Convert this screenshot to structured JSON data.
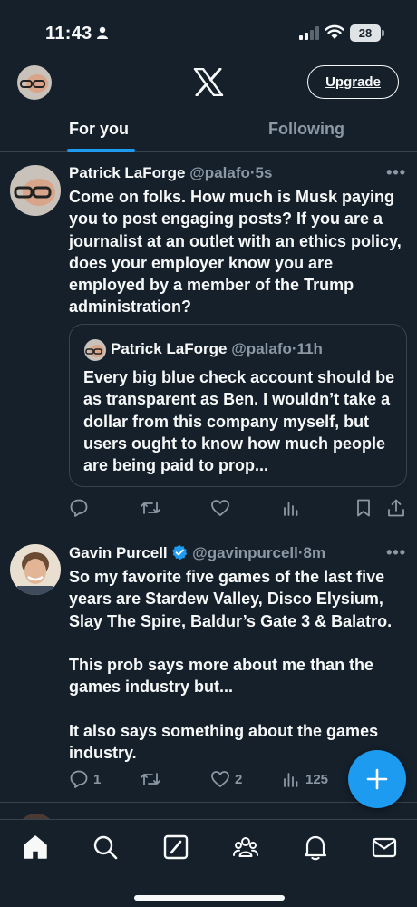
{
  "status_bar": {
    "time": "11:43",
    "battery": "28"
  },
  "header": {
    "logo": "x-logo",
    "upgrade_label": "Upgrade"
  },
  "tabs": [
    {
      "label": "For you",
      "active": true
    },
    {
      "label": "Following",
      "active": false
    }
  ],
  "posts": [
    {
      "author": "Patrick LaForge",
      "handle": "@palafo",
      "time": "5s",
      "verified": false,
      "text": "Come on folks. How much is Musk paying you to post engaging posts? If you are a journalist at an outlet with an ethics policy, does your employer know you are employed by a member of the Trump administration?",
      "quote": {
        "author": "Patrick LaForge",
        "handle": "@palafo",
        "time": "11h",
        "text": "Every big blue check account should be as transparent as Ben. I wouldn’t take a dollar from this company myself, but users ought to know how much people are being paid to prop..."
      },
      "actions": {
        "replies": "",
        "reposts": "",
        "likes": "",
        "views": ""
      }
    },
    {
      "author": "Gavin Purcell",
      "handle": "@gavinpurcell",
      "time": "8m",
      "verified": true,
      "text": "So my favorite five games of the last five years are Stardew Valley, Disco Elysium, Slay The Spire, Baldur’s Gate 3 & Balatro.\n\nThis prob says more about me than the games industry but...\n\nIt also says something about the games industry.",
      "actions": {
        "replies": "1",
        "reposts": "",
        "likes": "2",
        "views": "125"
      }
    }
  ],
  "bottom_nav": [
    "home-icon",
    "search-icon",
    "grok-icon",
    "communities-icon",
    "notifications-icon",
    "messages-icon"
  ],
  "colors": {
    "background": "#15202b",
    "accent": "#1d9bf0",
    "text": "#f7f9f9",
    "muted": "#8b98a5",
    "border": "#38444d"
  }
}
